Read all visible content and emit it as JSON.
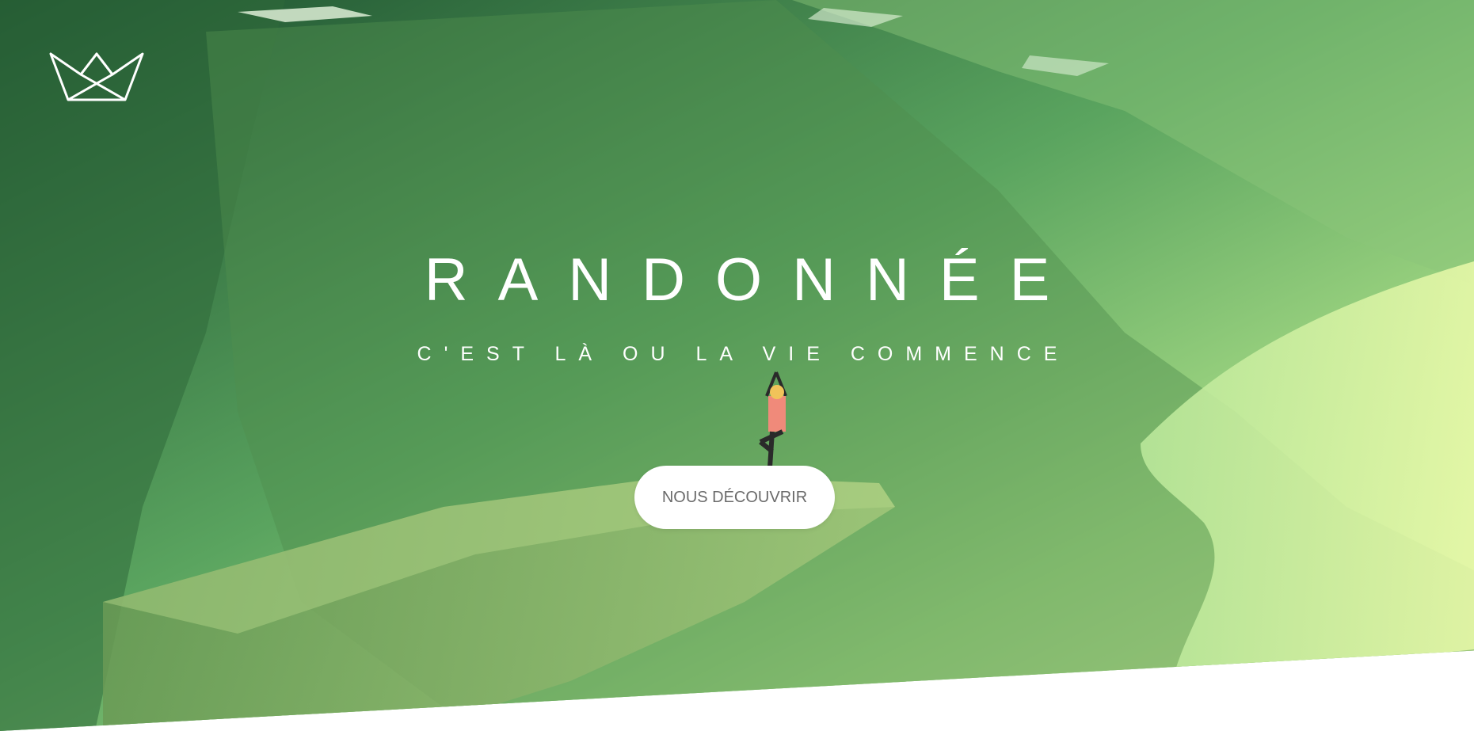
{
  "hero": {
    "title": "RANDONNÉE",
    "subtitle": "C'EST LÀ OU LA VIE COMMENCE",
    "cta_label": "NOUS DÉCOUVRIR",
    "logo_icon": "crown-icon",
    "background_image": "hiker-on-cliff-photo"
  },
  "colors": {
    "overlay_dark": "#1f5a33",
    "overlay_light": "#d8f5a0",
    "text": "#ffffff",
    "button_bg": "#ffffff",
    "button_text": "#6a6a6a"
  }
}
